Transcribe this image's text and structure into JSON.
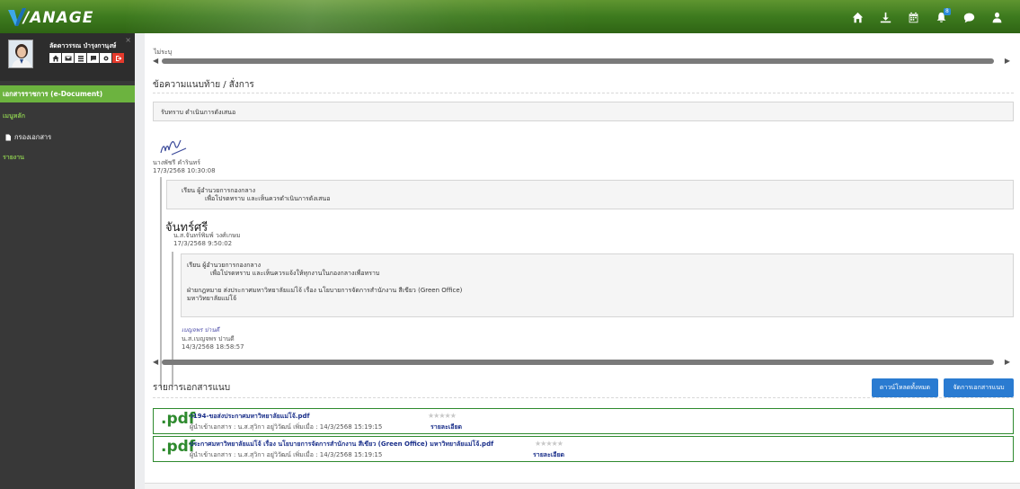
{
  "app": {
    "logo_text": "/ANAGE"
  },
  "topbar": {
    "notif_count": "8"
  },
  "user": {
    "name": "ลัดดาวรรณ บำรุงกานุงษ์"
  },
  "sidebar": {
    "header": "เอกสารราชการ (e-Document)",
    "main_menu": "เมนูหลัก",
    "filter_docs": "กรองเอกสาร",
    "report": "รายงาน"
  },
  "main": {
    "unspecified_label": "ไม่ระบุ",
    "notes_title": "ข้อความแนบท้าย / สั่งการ",
    "command_text": "รับทราบ ดำเนินการดังเสนอ",
    "sig1": {
      "name": "นางพัชรี คำรินทร์",
      "date": "17/3/2568 10:30:08"
    },
    "memo1": {
      "line1": "เรียน  ผู้อำนวยการกองกลาง",
      "line2": "เพื่อโปรดทราบ และเห็นควรดำเนินการดังเสนอ"
    },
    "sig2": {
      "script": "จันทร์ศรี",
      "name": "น.ส.จันทร์พิมพ์ วงศ์เกษม",
      "date": "17/3/2568 9:50:02"
    },
    "memo2": {
      "line1": "เรียน  ผู้อำนวยการกองกลาง",
      "line2": "เพื่อโปรดทราบ และเห็นควรแจ้งให้ทุกงานในกองกลางเพื่อทราบ",
      "line3": "ฝ่ายกฎหมาย ส่งประกาศมหาวิทยาลัยแม่โจ้ เรื่อง นโยบายการจัดการสำนักงาน สีเขียว (Green Office)",
      "line4": "มหาวิทยาลัยแม่โจ้"
    },
    "sig3": {
      "script": "เบญจพร ปานดี",
      "name": "น.ส.เบญจพร ปานดี",
      "date": "14/3/2568 18:58:57"
    },
    "attachments_title": "รายการเอกสารแนบ",
    "download_all": "ดาวน์โหลดทั้งหมด",
    "manage_attachments": "จัดการเอกสารแนบ",
    "attachments": [
      {
        "ext": ".pdf",
        "name": "ว194-ขอส่งประกาศมหาวิทยาลัยแม่โจ้.pdf",
        "info": "ผู้นำเข้าเอกสาร : น.ส.สุวิกา อยู่วิวัฒน์ เพิ่มเมื่อ : 14/3/2568 15:19:15",
        "detail": "รายละเอียด",
        "stars": "★★★★★"
      },
      {
        "ext": ".pdf",
        "name": "ประกาศมหาวิทยาลัยแม่โจ้ เรื่อง นโยบายการจัดการสำนักงาน สีเขียว (Green Office) มหาวิทยาลัยแม่โจ้.pdf",
        "info": "ผู้นำเข้าเอกสาร : น.ส.สุวิกา อยู่วิวัฒน์ เพิ่มเมื่อ : 14/3/2568 15:19:15",
        "detail": "รายละเอียด",
        "stars": "★★★★★"
      }
    ]
  }
}
